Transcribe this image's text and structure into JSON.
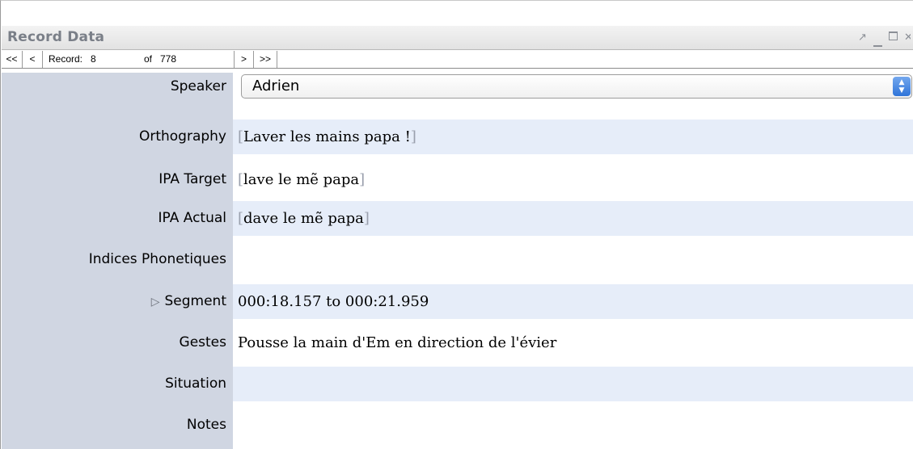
{
  "panel": {
    "title": "Record Data",
    "window_controls": [
      "undock-icon",
      "minimize-icon",
      "maximize-icon",
      "close-icon"
    ]
  },
  "nav": {
    "first": "<<",
    "prev": "<",
    "record_label": "Record:",
    "record_number": "8",
    "of_label": "of",
    "total": "778",
    "next": ">",
    "last": ">>"
  },
  "fields": {
    "speaker": {
      "label": "Speaker",
      "value": "Adrien"
    },
    "orthography": {
      "label": "Orthography",
      "open": "[",
      "value": "Laver les mains papa !",
      "close": "]"
    },
    "ipa_target": {
      "label": "IPA Target",
      "open": "[",
      "value": "lave le mẽ papa",
      "close": "]"
    },
    "ipa_actual": {
      "label": "IPA Actual",
      "open": "[",
      "value": "dave le mẽ papa",
      "close": "]"
    },
    "indices": {
      "label": "Indices Phonetiques",
      "value": ""
    },
    "segment": {
      "label": "Segment",
      "value": "000:18.157 to 000:21.959"
    },
    "gestes": {
      "label": "Gestes",
      "value": "Pousse la main d'Em en direction de l'évier"
    },
    "situation": {
      "label": "Situation",
      "value": ""
    },
    "notes": {
      "label": "Notes",
      "value": ""
    }
  },
  "colors": {
    "label_column": "#d0d6e2",
    "alt_row": "#e6edf9",
    "select_arrow": "#2f74d9"
  }
}
